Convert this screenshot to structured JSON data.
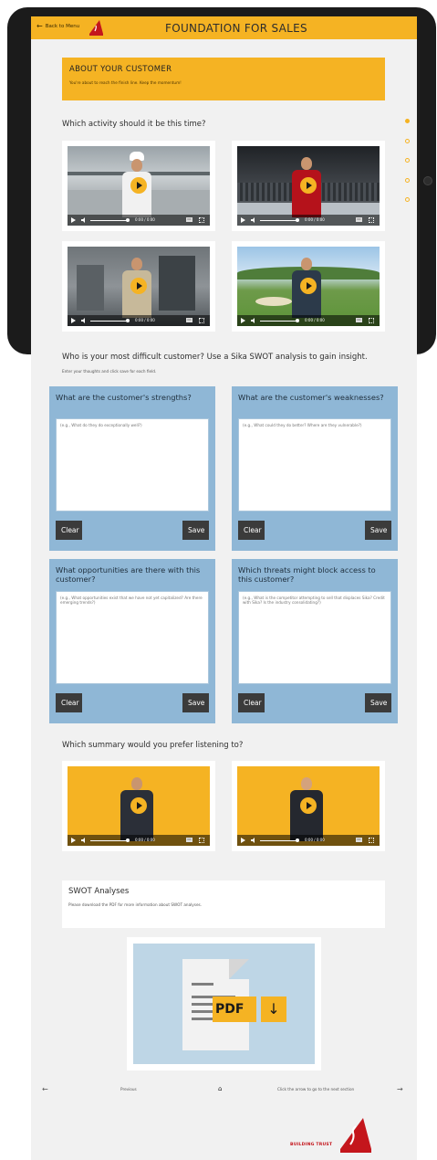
{
  "header": {
    "back_label": "Back to Menu",
    "title": "FOUNDATION FOR SALES"
  },
  "about": {
    "title": "ABOUT YOUR CUSTOMER",
    "subtitle": "You're about to reach the finish line. Keep the momentum!"
  },
  "activity": {
    "question": "Which activity should it be this time?",
    "videos": [
      {
        "scene": "chef-kitchen",
        "time": "0:00 / 0:00"
      },
      {
        "scene": "hockey-arena",
        "time": "0:00 / 0:00"
      },
      {
        "scene": "factory",
        "time": "0:00 / 0:00"
      },
      {
        "scene": "golf-course",
        "time": "0:00 / 0:00"
      }
    ]
  },
  "side_nav": {
    "dots": 5,
    "active": 0
  },
  "swot": {
    "question": "Who is your most difficult customer? Use a Sika SWOT analysis to gain insight.",
    "instructions": "Enter your thoughts and click save for each field.",
    "clear_label": "Clear",
    "save_label": "Save",
    "cards": [
      {
        "title": "What are the customer's strengths?",
        "placeholder": "(e.g., What do they do exceptionally well?)"
      },
      {
        "title": "What are the customer's weaknesses?",
        "placeholder": "(e.g., What could they do better? Where are they vulnerable?)"
      },
      {
        "title": "What opportunities are there with this customer?",
        "placeholder": "(e.g., What opportunities exist that we have not yet capitalized? Are there emerging trends?)"
      },
      {
        "title": "Which threats might block access to this customer?",
        "placeholder": "(e.g., What is the competitor attempting to sell that displaces Sika? Credit with Sika? Is the industry consolidating?)"
      }
    ]
  },
  "summary": {
    "question": "Which summary would you prefer listening to?",
    "videos": [
      {
        "time": "0:00 / 0:00"
      },
      {
        "time": "0:00 / 0:00"
      }
    ]
  },
  "swot_download": {
    "title": "SWOT Analyses",
    "subtitle": "Please download the PDF for more information about SWOT analyses.",
    "pdf_label": "PDF"
  },
  "footer": {
    "prev_label": "Previous",
    "next_label": "Click the arrow to go to the next section",
    "tagline": "BUILDING TRUST"
  },
  "colors": {
    "accent": "#f5b323",
    "swot_card": "#8fb7d6",
    "button_dark": "#3b3b3b",
    "brand_red": "#c4161c"
  }
}
